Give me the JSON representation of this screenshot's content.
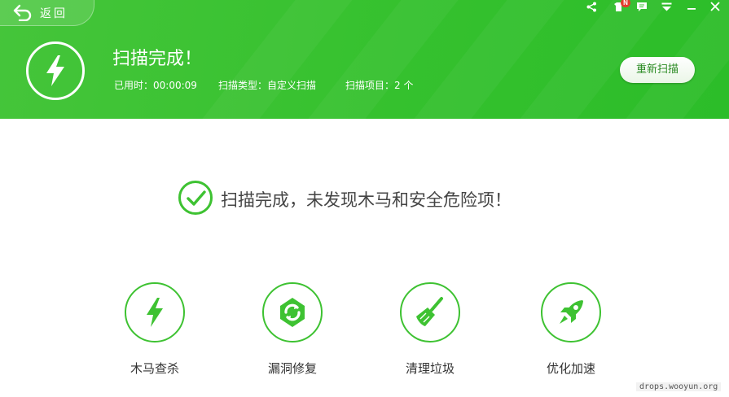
{
  "colors": {
    "brand_green": "#35c12e",
    "accent_green": "#3ec232",
    "badge_red": "#e53a2e"
  },
  "header": {
    "back_label": "返回",
    "back_icon": "back-arrow-icon",
    "notification_badge": "N",
    "window_controls": [
      "share-icon",
      "skin-icon",
      "message-icon",
      "menu-icon",
      "minimize-icon",
      "close-icon"
    ],
    "status_icon": "lightning-icon",
    "title": "扫描完成！",
    "elapsed": "已用时：00:00:09",
    "scan_type": "扫描类型：自定义扫描",
    "scan_items": "扫描项目：2 个",
    "rescan_label": "重新扫描"
  },
  "result": {
    "icon": "check-icon",
    "message": "扫描完成，未发现木马和安全危险项！"
  },
  "tools": [
    {
      "label": "木马查杀",
      "icon": "lightning-icon"
    },
    {
      "label": "漏洞修复",
      "icon": "repair-icon"
    },
    {
      "label": "清理垃圾",
      "icon": "broom-icon"
    },
    {
      "label": "优化加速",
      "icon": "rocket-icon"
    }
  ],
  "watermark": "drops.wooyun.org"
}
